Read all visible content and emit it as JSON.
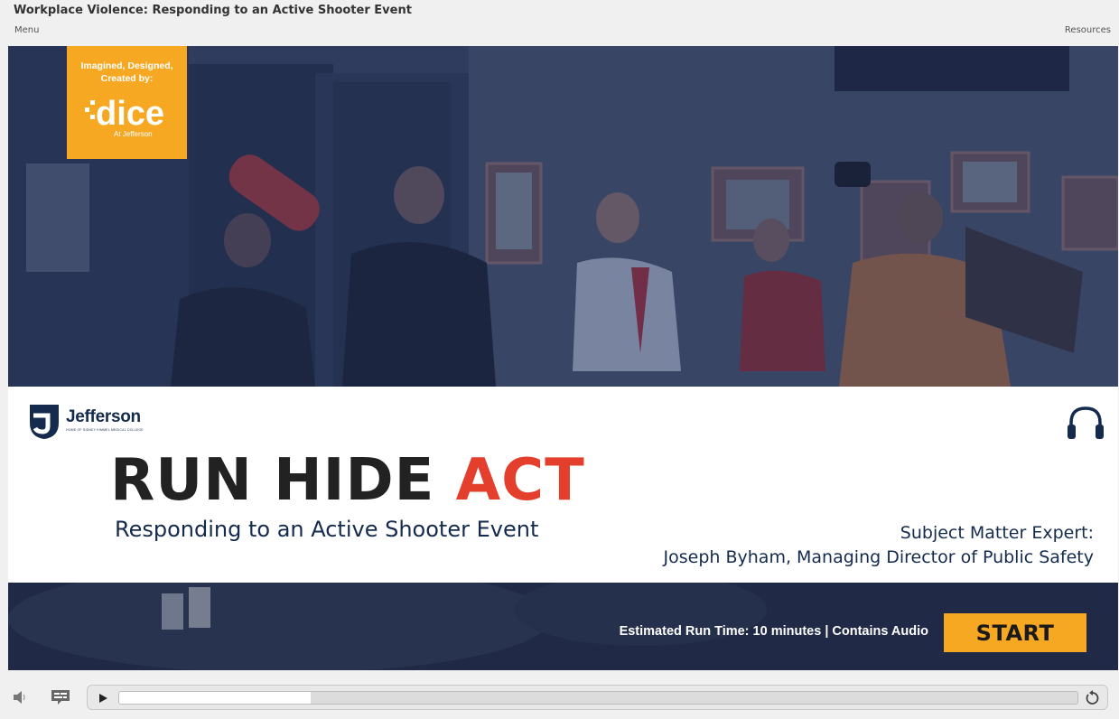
{
  "header": {
    "course_title": "Workplace Violence: Responding to an Active Shooter Event",
    "menu_label": "Menu",
    "resources_label": "Resources"
  },
  "badge": {
    "line1": "Imagined, Designed,",
    "line2": "Created by:",
    "logo_text": "dice",
    "logo_sub": "At Jefferson"
  },
  "branding": {
    "org_name": "Jefferson",
    "org_sub": "HOME OF SIDNEY KIMMEL MEDICAL COLLEGE"
  },
  "title_slide": {
    "headline_part1": "RUN HIDE ",
    "headline_part2": "ACT",
    "subtitle": "Responding to an Active Shooter Event",
    "sme_label": "Subject Matter Expert:",
    "sme_name": "Joseph Byham, Managing Director of Public Safety",
    "runtime": "Estimated Run Time:  10 minutes |  Contains Audio",
    "start_label": "START"
  },
  "player": {
    "progress": 0.2,
    "icons": [
      "volume-icon",
      "captions-icon",
      "play-icon",
      "replay-icon",
      "headphones-icon"
    ]
  },
  "colors": {
    "accent_orange": "#f7a823",
    "accent_red": "#e43f2c",
    "navy": "#152b4e",
    "photo_tint": "#2a3552"
  }
}
